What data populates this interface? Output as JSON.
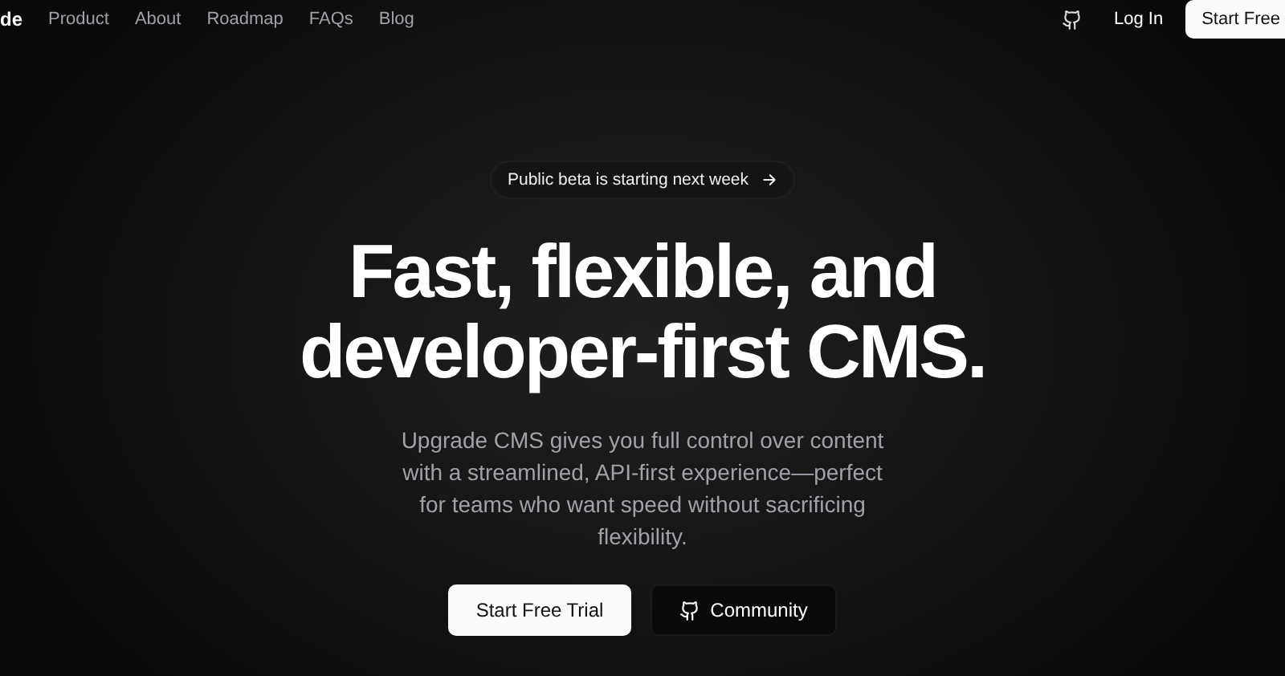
{
  "nav": {
    "logo": "de",
    "links": [
      "Product",
      "About",
      "Roadmap",
      "FAQs",
      "Blog"
    ],
    "login": "Log In",
    "cta": "Start Free"
  },
  "hero": {
    "badge": "Public beta is starting next week",
    "title_lines": [
      "Fast, flexible, and",
      "developer-first CMS."
    ],
    "subtitle": "Upgrade CMS gives you full control over content with a streamlined, API-first experience—perfect for teams who want speed without sacrificing flexibility.",
    "buttons": [
      {
        "label": "Start Free Trial",
        "kind": "primary"
      },
      {
        "label": "Community",
        "kind": "github"
      }
    ]
  }
}
